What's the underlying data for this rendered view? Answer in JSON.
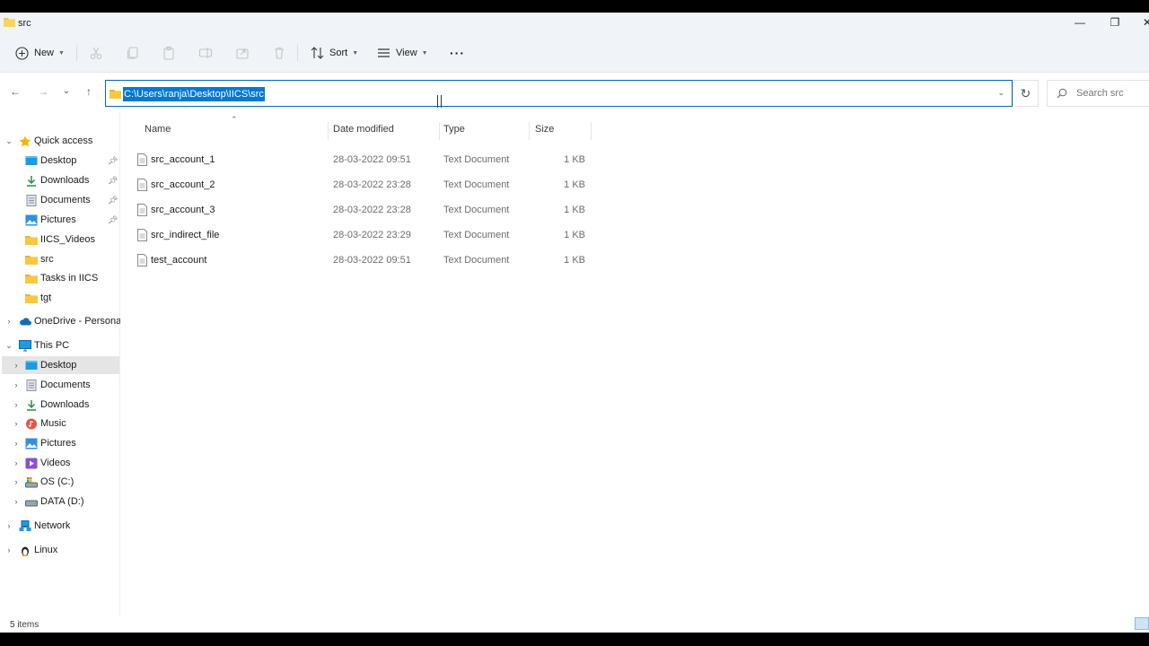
{
  "window": {
    "title": "src",
    "minimize_label": "—",
    "maximize_label": "❐",
    "close_label": "✕"
  },
  "command_bar": {
    "new_label": "New",
    "sort_label": "Sort",
    "view_label": "View",
    "more_label": "···",
    "disabled_icons": [
      "cut-icon",
      "copy-icon",
      "paste-icon",
      "rename-icon",
      "share-icon",
      "delete-icon"
    ]
  },
  "navigation": {
    "back_label": "←",
    "forward_label": "→",
    "recent_label": "⌄",
    "up_label": "↑",
    "address_path": "C:\\Users\\ranja\\Desktop\\IICS\\src",
    "refresh_label": "↻",
    "search_placeholder": "Search src"
  },
  "sidebar": {
    "quick_access": {
      "label": "Quick access",
      "items": [
        {
          "label": "Desktop",
          "icon": "desktop-icon",
          "pinned": true
        },
        {
          "label": "Downloads",
          "icon": "downloads-icon",
          "pinned": true
        },
        {
          "label": "Documents",
          "icon": "documents-icon",
          "pinned": true
        },
        {
          "label": "Pictures",
          "icon": "pictures-icon",
          "pinned": true
        },
        {
          "label": "IICS_Videos",
          "icon": "folder-icon",
          "pinned": false
        },
        {
          "label": "src",
          "icon": "folder-icon",
          "pinned": false
        },
        {
          "label": "Tasks in IICS",
          "icon": "folder-icon",
          "pinned": false
        },
        {
          "label": "tgt",
          "icon": "folder-icon",
          "pinned": false
        }
      ]
    },
    "onedrive": {
      "label": "OneDrive - Personal"
    },
    "this_pc": {
      "label": "This PC",
      "items": [
        {
          "label": "Desktop",
          "icon": "desktop-icon",
          "selected": true
        },
        {
          "label": "Documents",
          "icon": "documents-icon"
        },
        {
          "label": "Downloads",
          "icon": "downloads-icon"
        },
        {
          "label": "Music",
          "icon": "music-icon"
        },
        {
          "label": "Pictures",
          "icon": "pictures-icon"
        },
        {
          "label": "Videos",
          "icon": "videos-icon"
        },
        {
          "label": "OS (C:)",
          "icon": "drive-icon"
        },
        {
          "label": "DATA (D:)",
          "icon": "drive-icon"
        }
      ]
    },
    "network": {
      "label": "Network"
    },
    "linux": {
      "label": "Linux"
    }
  },
  "file_list": {
    "columns": {
      "name": "Name",
      "date": "Date modified",
      "type": "Type",
      "size": "Size"
    },
    "rows": [
      {
        "name": "src_account_1",
        "date": "28-03-2022 09:51",
        "type": "Text Document",
        "size": "1 KB"
      },
      {
        "name": "src_account_2",
        "date": "28-03-2022 23:28",
        "type": "Text Document",
        "size": "1 KB"
      },
      {
        "name": "src_account_3",
        "date": "28-03-2022 23:28",
        "type": "Text Document",
        "size": "1 KB"
      },
      {
        "name": "src_indirect_file",
        "date": "28-03-2022 23:29",
        "type": "Text Document",
        "size": "1 KB"
      },
      {
        "name": "test_account",
        "date": "28-03-2022 09:51",
        "type": "Text Document",
        "size": "1 KB"
      }
    ]
  },
  "status": {
    "items_text": "5 items"
  },
  "colors": {
    "accent": "#0078d7",
    "folder": "#f8c93f",
    "selected_bg": "#e5e5e5",
    "chrome_bg": "#f0f4f9"
  }
}
